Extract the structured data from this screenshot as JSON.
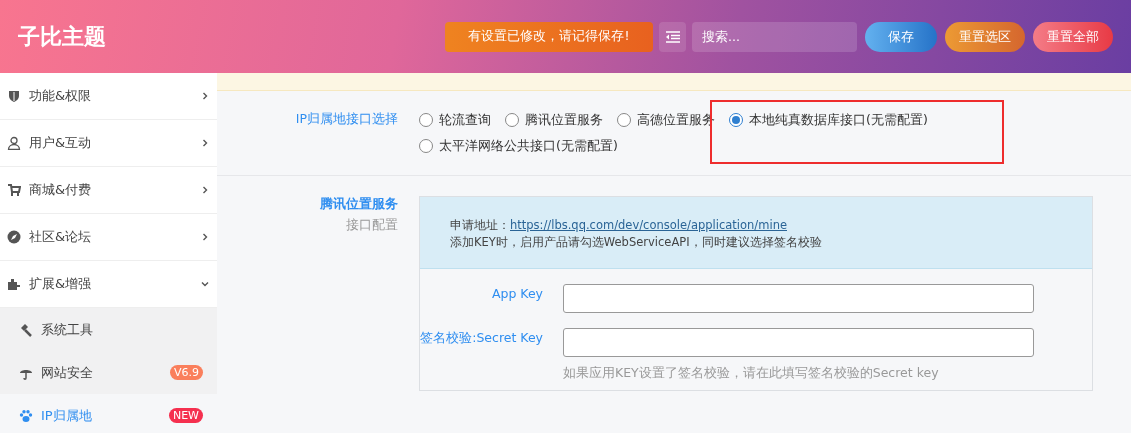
{
  "header": {
    "title": "子比主题",
    "notice": "有设置已修改，请记得保存!",
    "search": {
      "placeholder": "搜索..."
    },
    "buttons": [
      {
        "label": "保存",
        "kind": "save"
      },
      {
        "label": "重置选区",
        "kind": "reset-section"
      },
      {
        "label": "重置全部",
        "kind": "reset-all"
      }
    ]
  },
  "sidebar": {
    "items": [
      {
        "label": "功能&权限",
        "expanded": false
      },
      {
        "label": "用户&互动",
        "expanded": false
      },
      {
        "label": "商城&付费",
        "expanded": false
      },
      {
        "label": "社区&论坛",
        "expanded": false
      },
      {
        "label": "扩展&增强",
        "expanded": true,
        "children": [
          {
            "label": "系统工具",
            "selected": false
          },
          {
            "label": "网站安全",
            "selected": false,
            "badge": "V6.9",
            "color": "#fa7f5c"
          },
          {
            "label": "IP归属地",
            "selected": true,
            "badge": "NEW",
            "color": "#f5304f"
          }
        ]
      }
    ]
  },
  "sections": [
    {
      "kind": "radio",
      "label": "IP归属地接口选择",
      "options": [
        {
          "label": "轮流查询",
          "selected": false
        },
        {
          "label": "腾讯位置服务",
          "selected": false
        },
        {
          "label": "高德位置服务",
          "selected": false
        },
        {
          "label": "本地纯真数据库接口(无需配置)",
          "selected": true
        },
        {
          "label": "太平洋网络公共接口(无需配置)",
          "selected": false
        }
      ]
    },
    {
      "kind": "group",
      "label": "腾讯位置服务",
      "sublabel": "接口配置",
      "info": {
        "prefix": "申请地址：",
        "link": "https://lbs.qq.com/dev/console/application/mine",
        "note": "添加KEY时，启用产品请勾选WebServiceAPI，同时建议选择签名校验"
      },
      "fields": [
        {
          "label": "App Key"
        },
        {
          "label": "签名校验:Secret Key",
          "help": "如果应用KEY设置了签名校验，请在此填写签名校验的Secret key"
        }
      ]
    }
  ]
}
